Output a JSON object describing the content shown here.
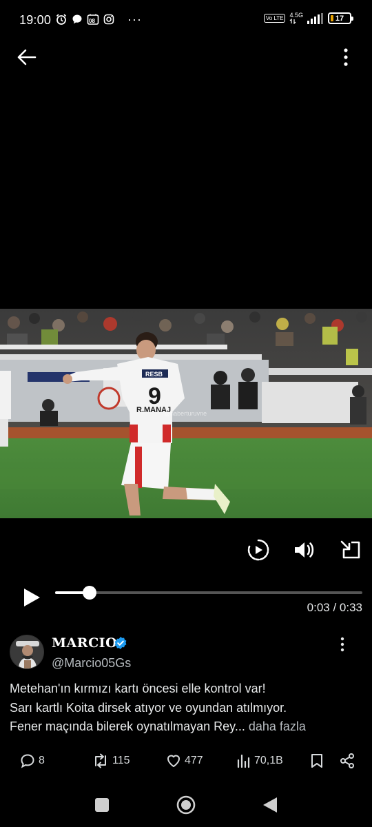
{
  "status_bar": {
    "time": "19:00",
    "notification_badge": "08",
    "more_indicator": "···",
    "volte_label": "Vo LTE",
    "network_label": "4.5G",
    "battery_level": "17",
    "battery_color": "#e8a200"
  },
  "video": {
    "jersey_number": "9",
    "jersey_name": "R.MANAJ",
    "sponsor": "RESB",
    "watermark": "@haberturuvne"
  },
  "player": {
    "progress_fraction": 0.112,
    "current_time": "0:03",
    "separator": " / ",
    "duration": "0:33",
    "icons": [
      "replay-icon",
      "volume-icon",
      "exit-fullscreen-icon",
      "play-icon"
    ]
  },
  "tweet": {
    "author_name": "MARCIO",
    "author_handle": "@Marcio05Gs",
    "verified_color": "#1d9bf0",
    "text_lines": [
      "Metehan'ın kırmızı kartı öncesi elle kontrol var!",
      "Sarı kartlı Koita dirsek atıyor ve oyundan atılmıyor.",
      "Fener maçında bilerek oynatılmayan Rey..."
    ],
    "show_more_label": "daha fazla"
  },
  "actions": {
    "replies": "8",
    "reposts": "115",
    "likes": "477",
    "views": "70,1B"
  },
  "nav": {
    "buttons": [
      "recents-button",
      "home-button",
      "back-button"
    ]
  }
}
